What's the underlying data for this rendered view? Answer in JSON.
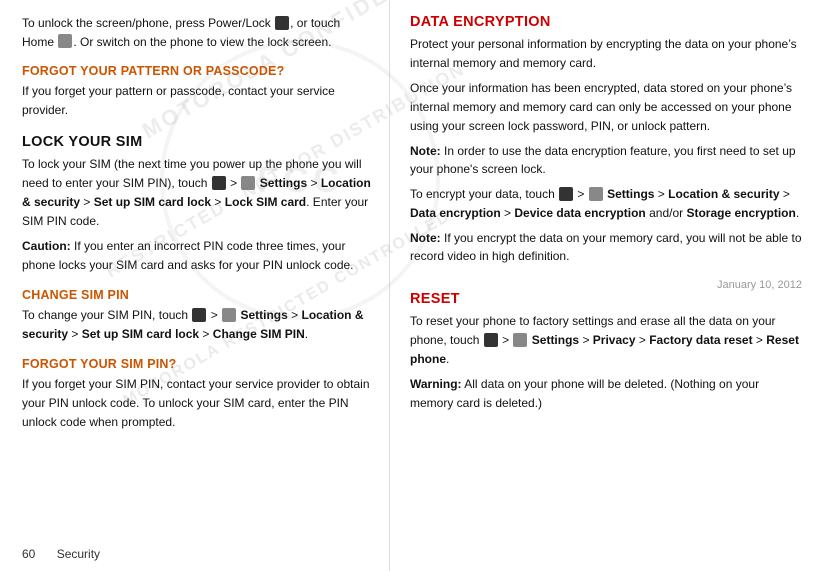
{
  "page": {
    "number": "60",
    "section": "Security"
  },
  "left": {
    "intro": {
      "line1": "To unlock the screen/phone, press Power/Lock",
      "line1b": ", or",
      "line2": "touch Home",
      "line2b": ". Or switch on the phone to view the",
      "line3": "lock screen."
    },
    "forgot_pattern": {
      "heading": "FORGOT YOUR PATTERN OR PASSCODE?",
      "body": "If you forget your pattern or passcode, contact your service provider."
    },
    "lock_sim": {
      "heading": "LOCK YOUR SIM",
      "body1_pre": "To lock your SIM (the next time you power up the phone you will need to enter your SIM PIN), touch",
      "body1_mid": ">",
      "body1_settings": "Settings",
      "body1_path": "> Location & security > Set up SIM card lock > Lock SIM card",
      "body1_end": ". Enter your SIM PIN code.",
      "caution_label": "Caution:",
      "caution_body": " If you enter an incorrect PIN code three times, your phone locks your SIM card and asks for your PIN unlock code."
    },
    "change_sim_pin": {
      "heading": "CHANGE SIM PIN",
      "body_pre": "To change your SIM PIN, touch",
      "body_mid": ">",
      "body_settings": "Settings",
      "body_path": "> Location & security > Set up SIM card lock > Change SIM PIN",
      "body_end": "."
    },
    "forgot_sim_pin": {
      "heading": "FORGOT YOUR SIM PIN?",
      "body": "If you forget your SIM PIN, contact your service provider to obtain your PIN unlock code. To unlock your SIM card, enter the PIN unlock code when prompted."
    }
  },
  "right": {
    "data_encryption": {
      "heading": "DATA ENCRYPTION",
      "para1": "Protect your personal information by encrypting the data on your phone’s internal memory and memory card.",
      "para2": "Once your information has been encrypted, data stored on your phone’s internal memory and memory card can only be accessed on your phone using your screen lock password, PIN, or unlock pattern.",
      "note1_label": "Note:",
      "note1_body": " In order to use the data encryption feature, you first need to set up your phone’s screen lock.",
      "para3_pre": "To encrypt your data, touch",
      "para3_mid": ">",
      "para3_settings": "Settings",
      "para3_path": "> Location & security > Data encryption > Device data encryption",
      "para3_end": " and/or Storage encryption.",
      "note2_label": "Note:",
      "note2_body": " If you encrypt the data on your memory card, you will not be able to record video in high definition."
    },
    "reset": {
      "heading": "RESET",
      "body_pre": "To reset your phone to factory settings and erase all the data on your phone, touch",
      "body_mid": ">",
      "body_settings": "Settings",
      "body_path": "> Privacy > Factory data reset > Reset phone",
      "body_end": ".",
      "warning_label": "Warning:",
      "warning_body": " All data on your phone will be deleted. (Nothing on your memory card is deleted.)"
    },
    "date": "January 10, 2012"
  },
  "icons": {
    "power_lock": "⏻",
    "home": "⌂",
    "menu_icon": "■",
    "settings_icon": "⚙"
  }
}
